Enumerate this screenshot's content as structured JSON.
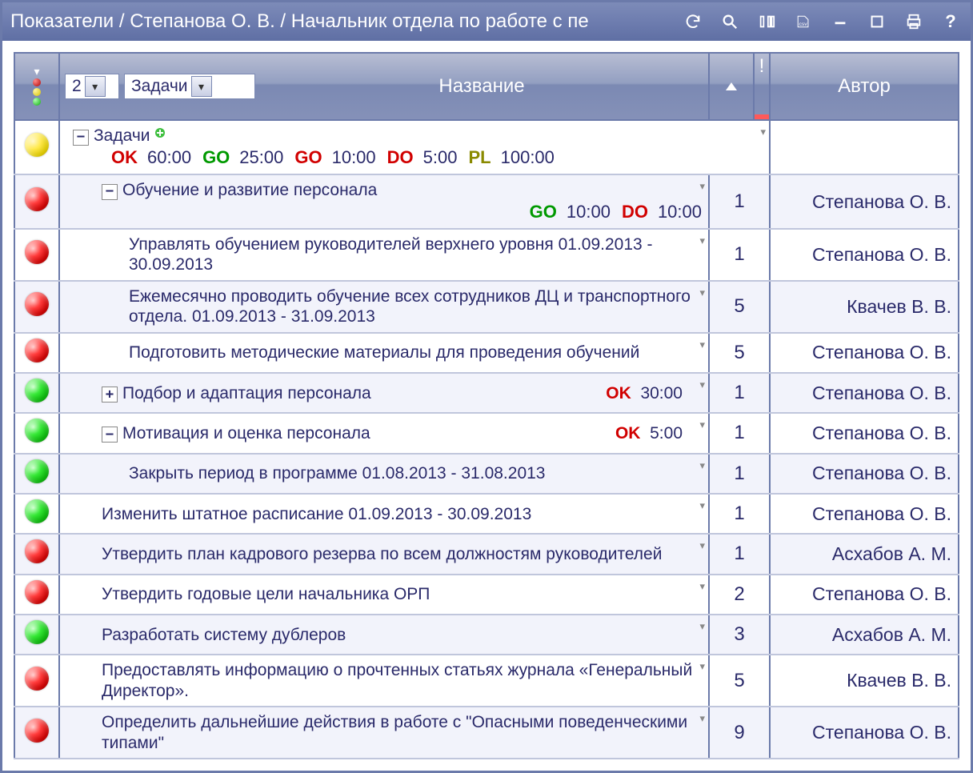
{
  "titlebar": {
    "title": "Показатели / Степанова О. В. / Начальник отдела по работе с пе"
  },
  "grid": {
    "header": {
      "level_value": "2",
      "type_value": "Задачи",
      "name_label": "Название",
      "priority_label": "!",
      "author_label": "Автор"
    },
    "summary_row": {
      "status": "yellow",
      "label": "Задачи",
      "statuses": [
        {
          "tag": "OK",
          "cls": "st-ok",
          "time": "60:00"
        },
        {
          "tag": "GO",
          "cls": "st-go",
          "time": "25:00"
        },
        {
          "tag": "GO",
          "cls": "st-go2",
          "time": "10:00"
        },
        {
          "tag": "DO",
          "cls": "st-do",
          "time": "5:00"
        },
        {
          "tag": "PL",
          "cls": "st-pl",
          "time": "100:00"
        }
      ]
    },
    "rows": [
      {
        "status": "red",
        "toggle": "minus",
        "indent": 2,
        "text": "Обучение и развитие персонала",
        "sub_statuses": [
          {
            "tag": "GO",
            "cls": "st-go",
            "time": "10:00"
          },
          {
            "tag": "DO",
            "cls": "st-do",
            "time": "10:00"
          }
        ],
        "priority": "1",
        "author": "Степанова О. В.",
        "alt": true
      },
      {
        "status": "red",
        "toggle": null,
        "indent": 3,
        "text": "Управлять обучением руководителей верхнего уровня 01.09.2013 - 30.09.2013",
        "priority": "1",
        "author": "Степанова О. В.",
        "alt": false
      },
      {
        "status": "red",
        "toggle": null,
        "indent": 3,
        "text": "Ежемесячно проводить обучение всех сотрудников ДЦ и транспортного отдела. 01.09.2013 - 31.09.2013",
        "priority": "5",
        "author": "Квачев В. В.",
        "alt": true
      },
      {
        "status": "red",
        "toggle": null,
        "indent": 3,
        "text": "Подготовить методические материалы для проведения обучений",
        "priority": "5",
        "author": "Степанова О. В.",
        "alt": false
      },
      {
        "status": "green",
        "toggle": "plus",
        "indent": 2,
        "text": "Подбор и адаптация персонала",
        "inline_status": {
          "tag": "OK",
          "cls": "st-ok-inline",
          "time": "30:00"
        },
        "priority": "1",
        "author": "Степанова О. В.",
        "alt": true
      },
      {
        "status": "green",
        "toggle": "minus",
        "indent": 2,
        "text": "Мотивация и оценка персонала",
        "inline_status": {
          "tag": "OK",
          "cls": "st-ok-inline",
          "time": "5:00"
        },
        "priority": "1",
        "author": "Степанова О. В.",
        "alt": false
      },
      {
        "status": "green",
        "toggle": null,
        "indent": 3,
        "text": "Закрыть период в программе 01.08.2013 - 31.08.2013",
        "priority": "1",
        "author": "Степанова О. В.",
        "alt": true
      },
      {
        "status": "green",
        "toggle": null,
        "indent": 2,
        "text": "Изменить штатное расписание 01.09.2013 - 30.09.2013",
        "priority": "1",
        "author": "Степанова О. В.",
        "alt": false
      },
      {
        "status": "red",
        "toggle": null,
        "indent": 2,
        "text": "Утвердить план кадрового резерва по всем должностям руководителей",
        "priority": "1",
        "author": "Асхабов А. М.",
        "alt": true
      },
      {
        "status": "red",
        "toggle": null,
        "indent": 2,
        "text": "Утвердить годовые цели начальника ОРП",
        "priority": "2",
        "author": "Степанова О. В.",
        "alt": false
      },
      {
        "status": "green",
        "toggle": null,
        "indent": 2,
        "text": "Разработать систему дублеров",
        "priority": "3",
        "author": "Асхабов А. М.",
        "alt": true
      },
      {
        "status": "red",
        "toggle": null,
        "indent": 2,
        "text": "Предоставлять информацию о прочтенных статьях журнала «Генеральный Директор».",
        "priority": "5",
        "author": "Квачев В. В.",
        "alt": false
      },
      {
        "status": "red",
        "toggle": null,
        "indent": 2,
        "text": "Определить дальнейшие действия в работе с \"Опасными поведенческими типами\"",
        "priority": "9",
        "author": "Степанова О. В.",
        "alt": true
      }
    ]
  }
}
